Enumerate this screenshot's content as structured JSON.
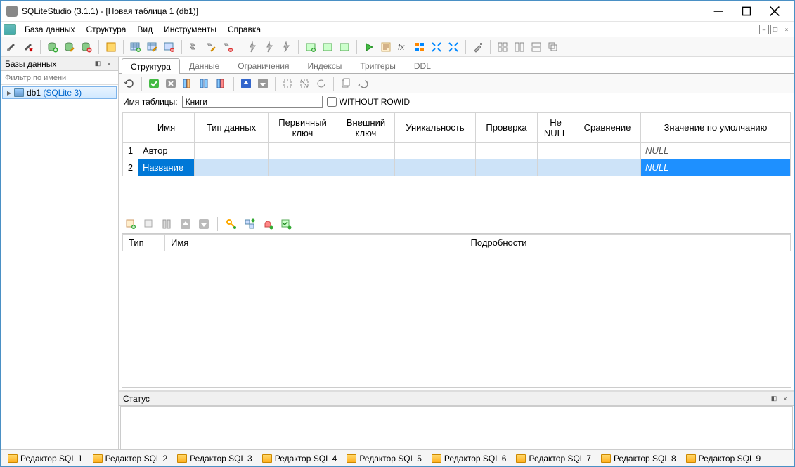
{
  "window": {
    "title": "SQLiteStudio (3.1.1) - [Новая таблица 1 (db1)]"
  },
  "menu": {
    "items": [
      "База данных",
      "Структура",
      "Вид",
      "Инструменты",
      "Справка"
    ]
  },
  "sidebar": {
    "title": "Базы данных",
    "filter_placeholder": "Фильтр по имени",
    "db": {
      "name": "db1",
      "driver": "SQLite 3"
    }
  },
  "tabs": {
    "items": [
      "Структура",
      "Данные",
      "Ограничения",
      "Индексы",
      "Триггеры",
      "DDL"
    ],
    "active_index": 0
  },
  "table_editor": {
    "name_label": "Имя таблицы:",
    "name_value": "Книги",
    "without_rowid_label": "WITHOUT ROWID",
    "without_rowid_checked": false
  },
  "columns_grid": {
    "headers": [
      "Имя",
      "Тип данных",
      "Первичный ключ",
      "Внешний ключ",
      "Уникальность",
      "Проверка",
      "Не NULL",
      "Сравнение",
      "Значение по умолчанию"
    ],
    "rows": [
      {
        "num": "1",
        "name": "Автор",
        "type": "",
        "pk": "",
        "fk": "",
        "uniq": "",
        "check": "",
        "notnull": "",
        "collate": "",
        "default": "NULL",
        "selected": false
      },
      {
        "num": "2",
        "name": "Название",
        "type": "",
        "pk": "",
        "fk": "",
        "uniq": "",
        "check": "",
        "notnull": "",
        "collate": "",
        "default": "NULL",
        "selected": true
      }
    ]
  },
  "constraints_grid": {
    "headers": [
      "Тип",
      "Имя",
      "Подробности"
    ]
  },
  "status": {
    "title": "Статус"
  },
  "bottom_tabs": {
    "items": [
      "Редактор SQL 1",
      "Редактор SQL 2",
      "Редактор SQL 3",
      "Редактор SQL 4",
      "Редактор SQL 5",
      "Редактор SQL 6",
      "Редактор SQL 7",
      "Редактор SQL 8",
      "Редактор SQL 9"
    ]
  },
  "icons": {
    "connect": "plug",
    "disconnect": "plug-x",
    "db_add": "db+",
    "db_edit": "db✎",
    "db_del": "db×",
    "refresh": "⟳",
    "commit": "✓",
    "rollback": "✗",
    "fx": "fx"
  }
}
